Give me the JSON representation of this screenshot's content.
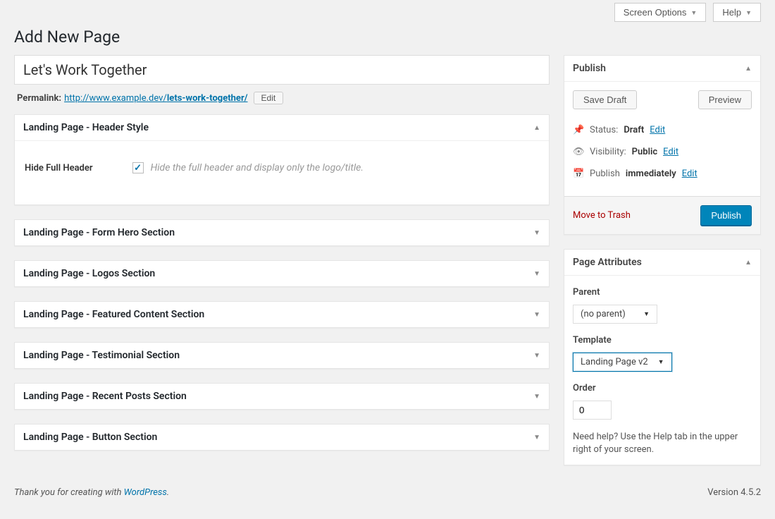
{
  "topbar": {
    "screen_options": "Screen Options",
    "help": "Help"
  },
  "page_heading": "Add New Page",
  "title_input": "Let's Work Together",
  "permalink": {
    "label": "Permalink:",
    "base": "http://www.example.dev/",
    "slug": "lets-work-together/",
    "edit_button": "Edit"
  },
  "metaboxes": [
    {
      "title": "Landing Page - Header Style",
      "open": true,
      "header_style": {
        "label": "Hide Full Header",
        "checked": true,
        "description": "Hide the full header and display only the logo/title."
      }
    },
    {
      "title": "Landing Page - Form Hero Section",
      "open": false
    },
    {
      "title": "Landing Page - Logos Section",
      "open": false
    },
    {
      "title": "Landing Page - Featured Content Section",
      "open": false
    },
    {
      "title": "Landing Page - Testimonial Section",
      "open": false
    },
    {
      "title": "Landing Page - Recent Posts Section",
      "open": false
    },
    {
      "title": "Landing Page - Button Section",
      "open": false
    }
  ],
  "publish": {
    "title": "Publish",
    "save_draft": "Save Draft",
    "preview": "Preview",
    "status_label": "Status:",
    "status_value": "Draft",
    "status_edit": "Edit",
    "visibility_label": "Visibility:",
    "visibility_value": "Public",
    "visibility_edit": "Edit",
    "schedule_label": "Publish",
    "schedule_value": "immediately",
    "schedule_edit": "Edit",
    "trash": "Move to Trash",
    "publish_button": "Publish"
  },
  "page_attributes": {
    "title": "Page Attributes",
    "parent_label": "Parent",
    "parent_value": "(no parent)",
    "template_label": "Template",
    "template_value": "Landing Page v2",
    "order_label": "Order",
    "order_value": "0",
    "help_text": "Need help? Use the Help tab in the upper right of your screen."
  },
  "footer": {
    "thanks_prefix": "Thank you for creating with ",
    "thanks_link": "WordPress",
    "thanks_suffix": ".",
    "version": "Version 4.5.2"
  }
}
